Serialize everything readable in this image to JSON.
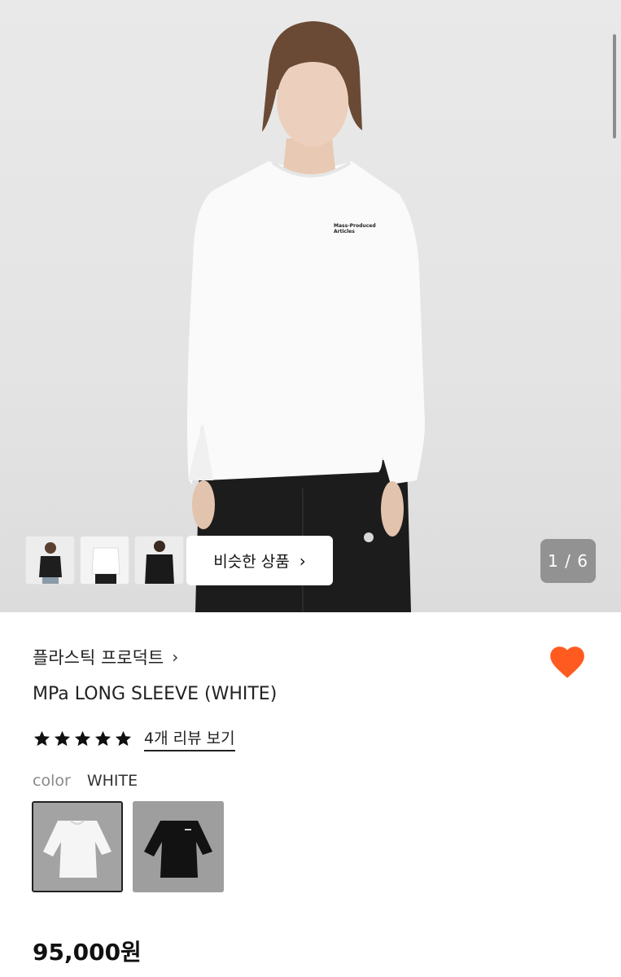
{
  "gallery": {
    "print_text_1": "Mass-Produced",
    "print_text_2": "Articles",
    "similar_button_label": "비슷한 상품",
    "counter": "1 / 6"
  },
  "product": {
    "brand": "플라스틱 프로덕트",
    "title": "MPa LONG SLEEVE (WHITE)",
    "review_link": "4개 리뷰 보기",
    "rating_stars": 5,
    "color_label": "color",
    "color_value": "WHITE",
    "price": "95,000원",
    "heart_color": "#ff5a1f"
  }
}
